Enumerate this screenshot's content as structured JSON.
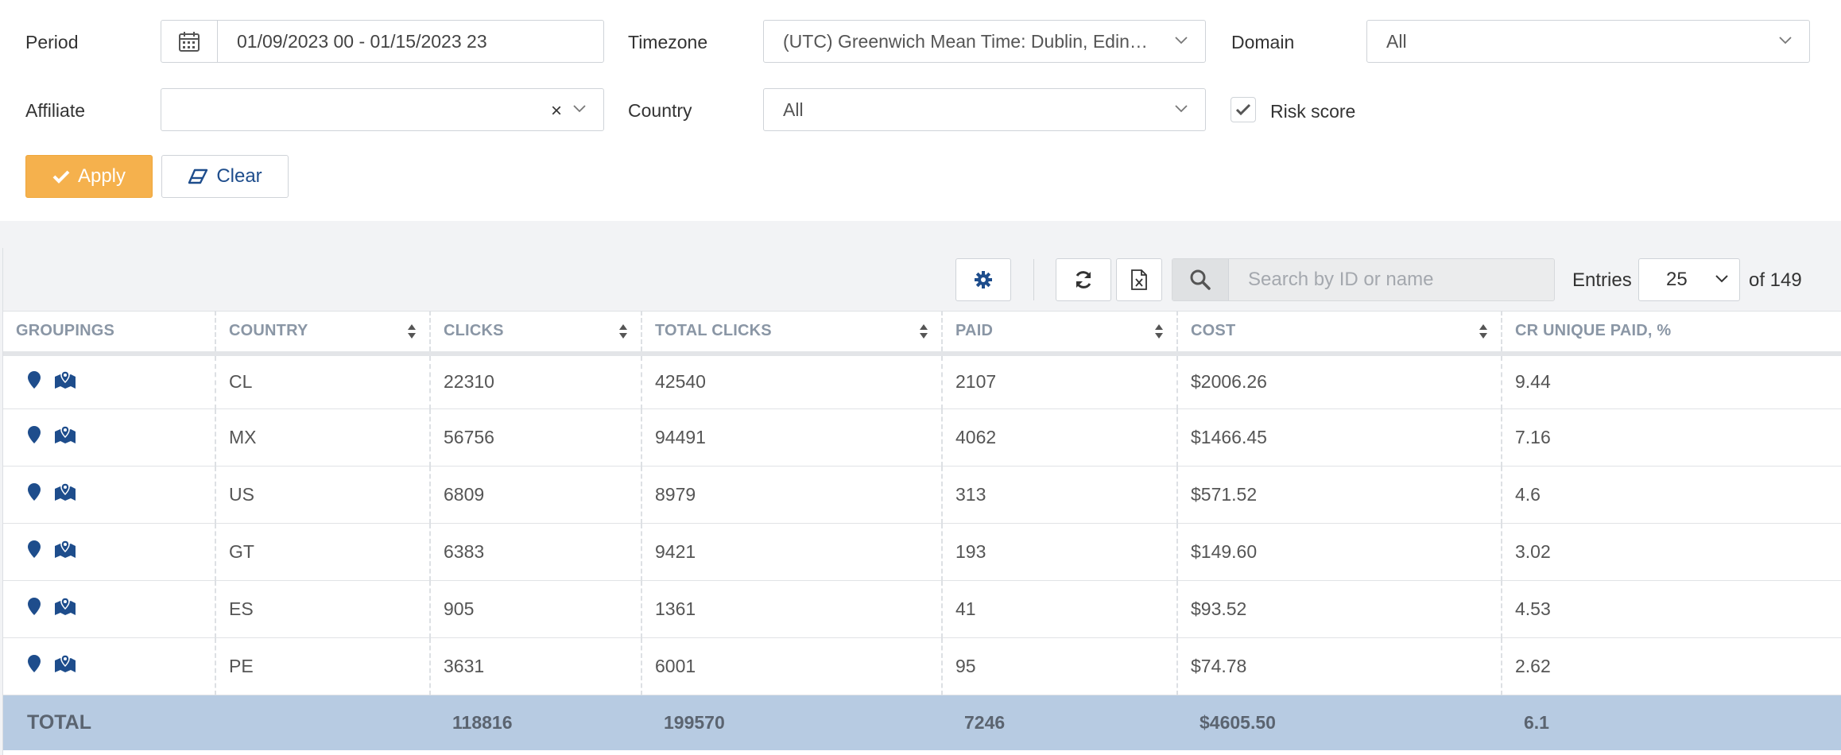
{
  "filters": {
    "period_label": "Period",
    "period_value": "01/09/2023 00 - 01/15/2023 23",
    "timezone_label": "Timezone",
    "timezone_value": "(UTC) Greenwich Mean Time: Dublin, Edinbur...",
    "domain_label": "Domain",
    "domain_value": "All",
    "affiliate_label": "Affiliate",
    "affiliate_value": "",
    "affiliate_clear": "×",
    "country_label": "Country",
    "country_value": "All",
    "risk_score_label": "Risk score",
    "risk_score_checked": true,
    "apply_label": "Apply",
    "clear_label": "Clear"
  },
  "toolbar": {
    "search_placeholder": "Search by ID or name",
    "entries_label": "Entries",
    "entries_value": "25",
    "of_total": "of 149"
  },
  "table": {
    "columns": [
      "GROUPINGS",
      "COUNTRY",
      "CLICKS",
      "TOTAL CLICKS",
      "PAID",
      "COST",
      "CR UNIQUE PAID, %"
    ],
    "rows": [
      {
        "country": "CL",
        "clicks": "22310",
        "total_clicks": "42540",
        "paid": "2107",
        "cost": "$2006.26",
        "cr": "9.44"
      },
      {
        "country": "MX",
        "clicks": "56756",
        "total_clicks": "94491",
        "paid": "4062",
        "cost": "$1466.45",
        "cr": "7.16"
      },
      {
        "country": "US",
        "clicks": "6809",
        "total_clicks": "8979",
        "paid": "313",
        "cost": "$571.52",
        "cr": "4.6"
      },
      {
        "country": "GT",
        "clicks": "6383",
        "total_clicks": "9421",
        "paid": "193",
        "cost": "$149.60",
        "cr": "3.02"
      },
      {
        "country": "ES",
        "clicks": "905",
        "total_clicks": "1361",
        "paid": "41",
        "cost": "$93.52",
        "cr": "4.53"
      },
      {
        "country": "PE",
        "clicks": "3631",
        "total_clicks": "6001",
        "paid": "95",
        "cost": "$74.78",
        "cr": "2.62"
      }
    ],
    "total": {
      "label": "TOTAL",
      "clicks": "118816",
      "total_clicks": "199570",
      "paid": "7246",
      "cost": "$4605.50",
      "cr": "6.1"
    }
  },
  "colors": {
    "accent": "#f5b14d",
    "brand": "#1e4d8c",
    "total_row": "#b7cbe2",
    "header_text": "#8a96a5"
  }
}
